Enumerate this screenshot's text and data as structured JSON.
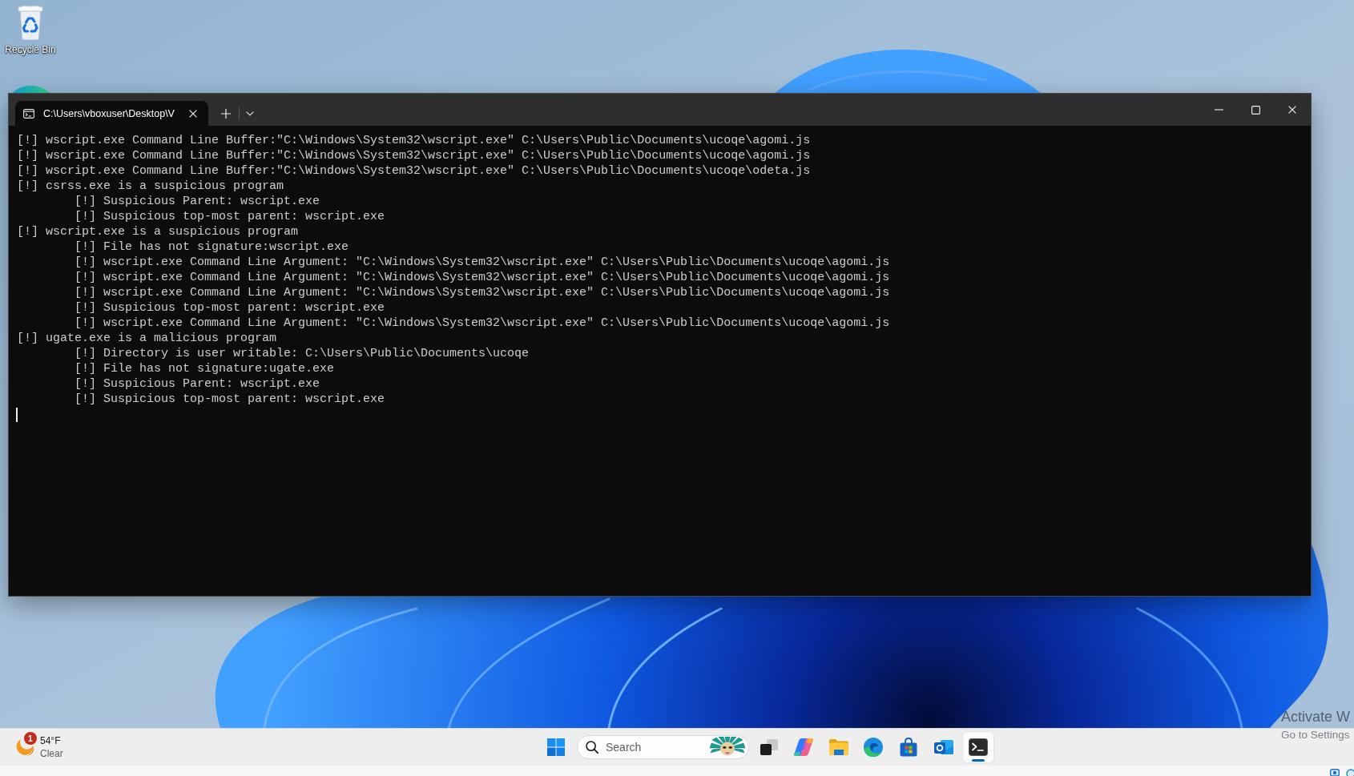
{
  "desktop": {
    "icons": [
      {
        "kind": "recycle_bin",
        "label": "Recycle Bin"
      },
      {
        "kind": "app"
      }
    ]
  },
  "window": {
    "tabs": [
      {
        "title": "C:\\Users\\vboxuser\\Desktop\\V",
        "selected": true
      }
    ],
    "lines": [
      {
        "text": "[!] wscript.exe Command Line Buffer:\"C:\\Windows\\System32\\wscript.exe\" C:\\Users\\Public\\Documents\\ucoqe\\agomi.js"
      },
      {
        "text": "[!] wscript.exe Command Line Buffer:\"C:\\Windows\\System32\\wscript.exe\" C:\\Users\\Public\\Documents\\ucoqe\\agomi.js"
      },
      {
        "text": "[!] wscript.exe Command Line Buffer:\"C:\\Windows\\System32\\wscript.exe\" C:\\Users\\Public\\Documents\\ucoqe\\odeta.js"
      },
      {
        "text": "[!] csrss.exe is a suspicious program",
        "children": [
          {
            "text": "[!] Suspicious Parent: wscript.exe"
          },
          {
            "text": "[!] Suspicious top-most parent: wscript.exe"
          }
        ]
      },
      {
        "text": "[!] wscript.exe is a suspicious program",
        "children": [
          {
            "text": "[!] File has not signature:wscript.exe"
          },
          {
            "text": "[!] wscript.exe Command Line Argument: \"C:\\Windows\\System32\\wscript.exe\" C:\\Users\\Public\\Documents\\ucoqe\\agomi.js"
          },
          {
            "text": "[!] wscript.exe Command Line Argument: \"C:\\Windows\\System32\\wscript.exe\" C:\\Users\\Public\\Documents\\ucoqe\\agomi.js"
          },
          {
            "text": "[!] wscript.exe Command Line Argument: \"C:\\Windows\\System32\\wscript.exe\" C:\\Users\\Public\\Documents\\ucoqe\\agomi.js"
          },
          {
            "text": "[!] Suspicious top-most parent: wscript.exe"
          },
          {
            "text": "[!] wscript.exe Command Line Argument: \"C:\\Windows\\System32\\wscript.exe\" C:\\Users\\Public\\Documents\\ucoqe\\agomi.js"
          }
        ]
      },
      {
        "text": "[!] ugate.exe is a malicious program",
        "children": [
          {
            "text": "[!] Directory is user writable: C:\\Users\\Public\\Documents\\ucoqe"
          },
          {
            "text": "[!] File has not signature:ugate.exe"
          },
          {
            "text": "[!] Suspicious Parent: wscript.exe"
          },
          {
            "text": "[!] Suspicious top-most parent: wscript.exe"
          }
        ]
      }
    ]
  },
  "taskbar": {
    "weather": {
      "badge": "1",
      "temperature": "54°F",
      "condition": "Clear"
    },
    "search": {
      "placeholder": "Search"
    },
    "apps": [
      {
        "kind": "task_view",
        "selected": false
      },
      {
        "kind": "copilot",
        "selected": false
      },
      {
        "kind": "file_explorer",
        "selected": false
      },
      {
        "kind": "edge",
        "selected": false
      },
      {
        "kind": "store",
        "selected": false
      },
      {
        "kind": "outlook",
        "selected": false
      },
      {
        "kind": "terminal",
        "selected": true
      }
    ]
  },
  "activation_notice": {
    "title": "Activate W",
    "subtitle": "Go to Settings"
  }
}
